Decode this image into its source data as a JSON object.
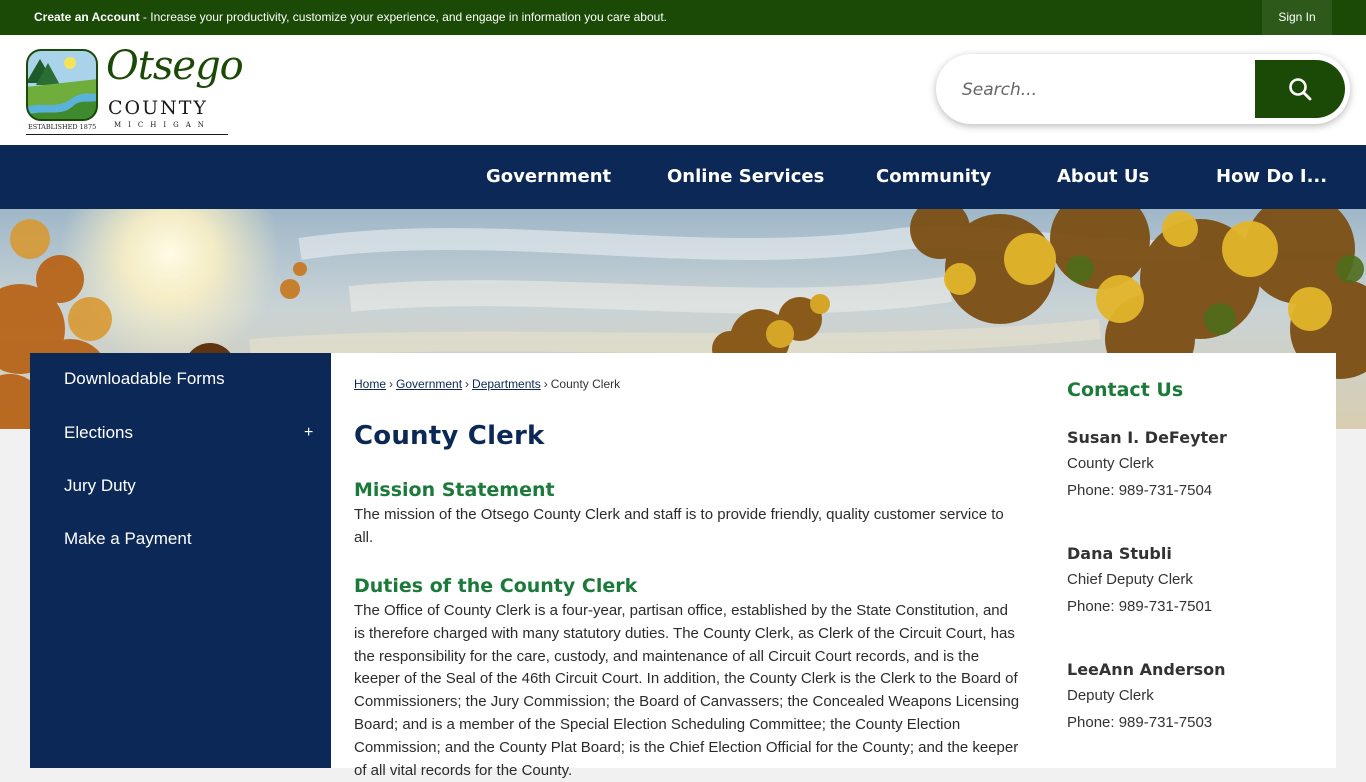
{
  "topbar": {
    "account_link": "Create an Account",
    "account_desc": " - Increase your productivity, customize your experience, and engage in information you care about.",
    "signin": "Sign In"
  },
  "header": {
    "logo": {
      "name_line1": "Otsego",
      "name_line2": "COUNTY",
      "state": "MICHIGAN",
      "established": "ESTABLISHED 1875"
    },
    "search": {
      "placeholder": "Search..."
    }
  },
  "nav": {
    "items": [
      "Government",
      "Online Services",
      "Community",
      "About Us",
      "How Do I..."
    ]
  },
  "sidebar": {
    "items": [
      {
        "label": "Downloadable Forms",
        "expandable": false
      },
      {
        "label": "Elections",
        "expandable": true,
        "toggle": "+"
      },
      {
        "label": "Jury Duty",
        "expandable": false
      },
      {
        "label": "Make a Payment",
        "expandable": false
      }
    ]
  },
  "breadcrumb": {
    "items": [
      "Home",
      "Government",
      "Departments"
    ],
    "current": "County Clerk",
    "separator": "›"
  },
  "main": {
    "title": "County Clerk",
    "mission_heading": "Mission Statement",
    "mission_text": "The mission of the Otsego County Clerk and staff is to provide friendly, quality customer service to all.",
    "duties_heading": "Duties of the County Clerk",
    "duties_text": "The Office of County Clerk is a four-year, partisan office, established by the State Constitution, and is therefore charged with many statutory duties. The County Clerk, as Clerk of the Circuit Court, has the responsibility for the care, custody, and maintenance of all Circuit Court records, and is the keeper of the Seal of the 46th Circuit Court. In addition, the County Clerk is the Clerk to the Board of Commissioners; the Jury Commission; the Board of Canvassers; the Concealed Weapons Licensing Board; and is a member of the Special Election Scheduling Committee; the County Election Commission; and the County Plat Board; is the Chief Election Official for the County; and the keeper of all vital records for the County."
  },
  "contact": {
    "title": "Contact Us",
    "people": [
      {
        "name": "Susan I. DeFeyter",
        "role": "County Clerk",
        "phone": "Phone: 989-731-7504"
      },
      {
        "name": "Dana Stubli",
        "role": "Chief Deputy Clerk",
        "phone": "Phone: 989-731-7501"
      },
      {
        "name": "LeeAnn Anderson",
        "role": "Deputy Clerk",
        "phone": "Phone: 989-731-7503"
      }
    ]
  },
  "colors": {
    "green_dark": "#1a4a06",
    "navy": "#0c2857",
    "heading_green": "#1b7a3a"
  }
}
